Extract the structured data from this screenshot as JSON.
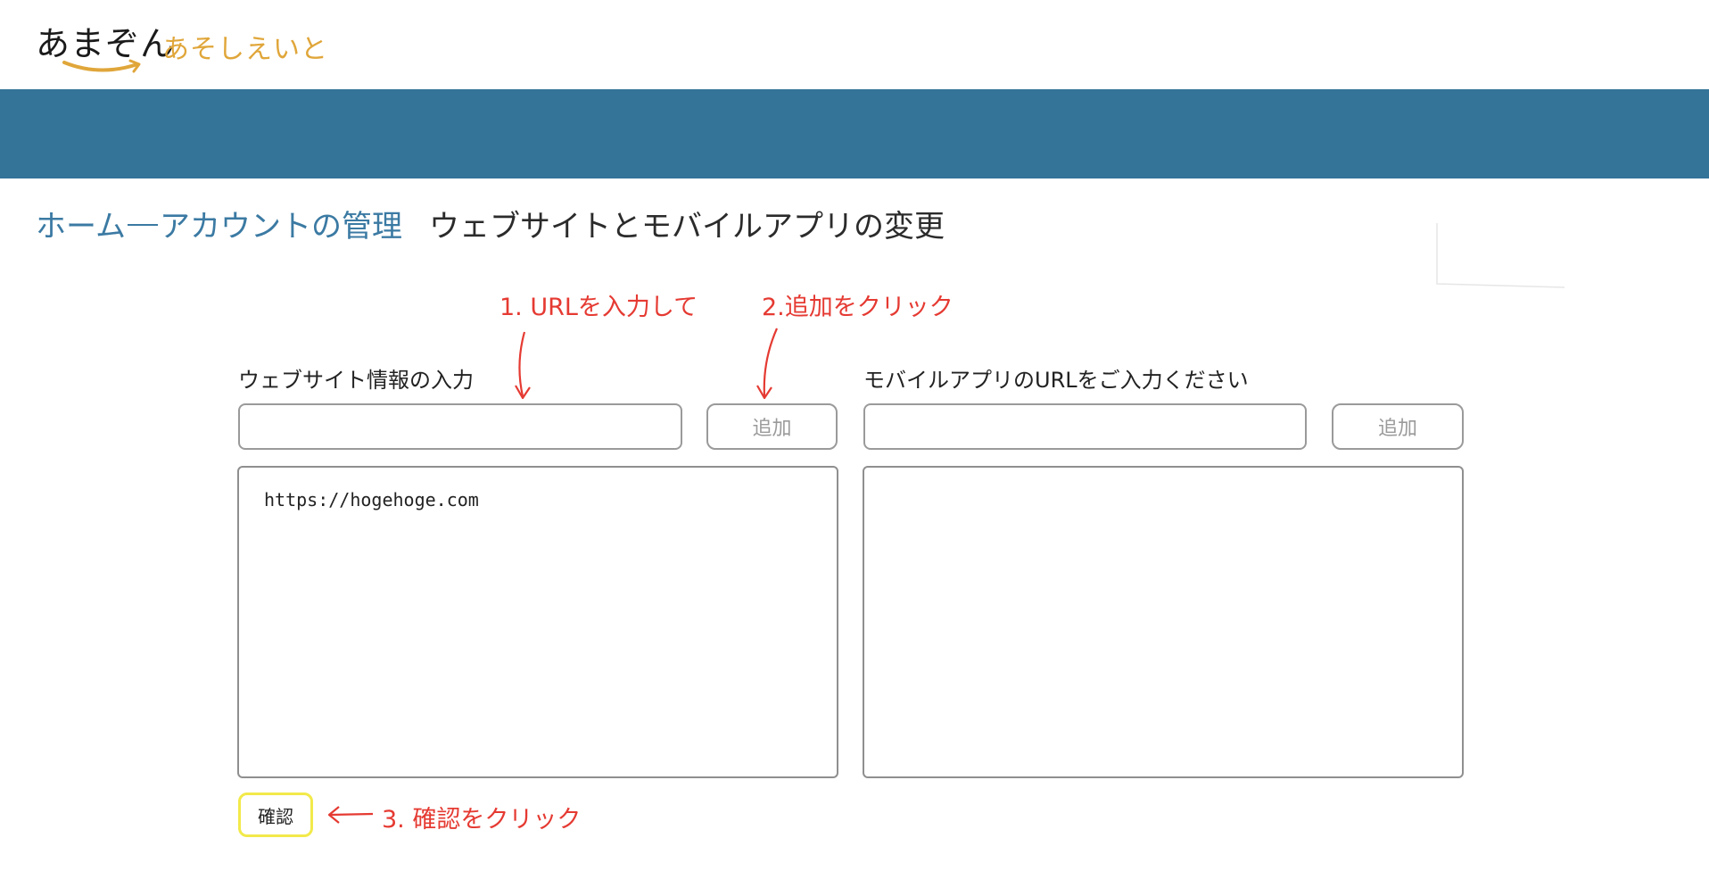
{
  "colors": {
    "banner": "#347498",
    "link": "#3b7aa3",
    "annotation": "#e53a32",
    "logo_accent": "#e0a63a",
    "confirm_border": "#f2ea4a"
  },
  "header": {
    "logo_main": "あまぞん",
    "logo_sub": "あそしえいと"
  },
  "breadcrumb": {
    "home": "ホーム",
    "account": "アカウントの管理",
    "current": "ウェブサイトとモバイルアプリの変更"
  },
  "annotations": {
    "step1": "1. URLを入力して",
    "step2": "2.追加をクリック",
    "step3": "3. 確認をクリック"
  },
  "website": {
    "label": "ウェブサイト情報の入力",
    "input_value": "",
    "add_label": "追加",
    "list": [
      "https://hogehoge.com"
    ]
  },
  "mobile": {
    "label": "モバイルアプリのURLをご入力ください",
    "input_value": "",
    "add_label": "追加",
    "list": []
  },
  "confirm_label": "確認"
}
